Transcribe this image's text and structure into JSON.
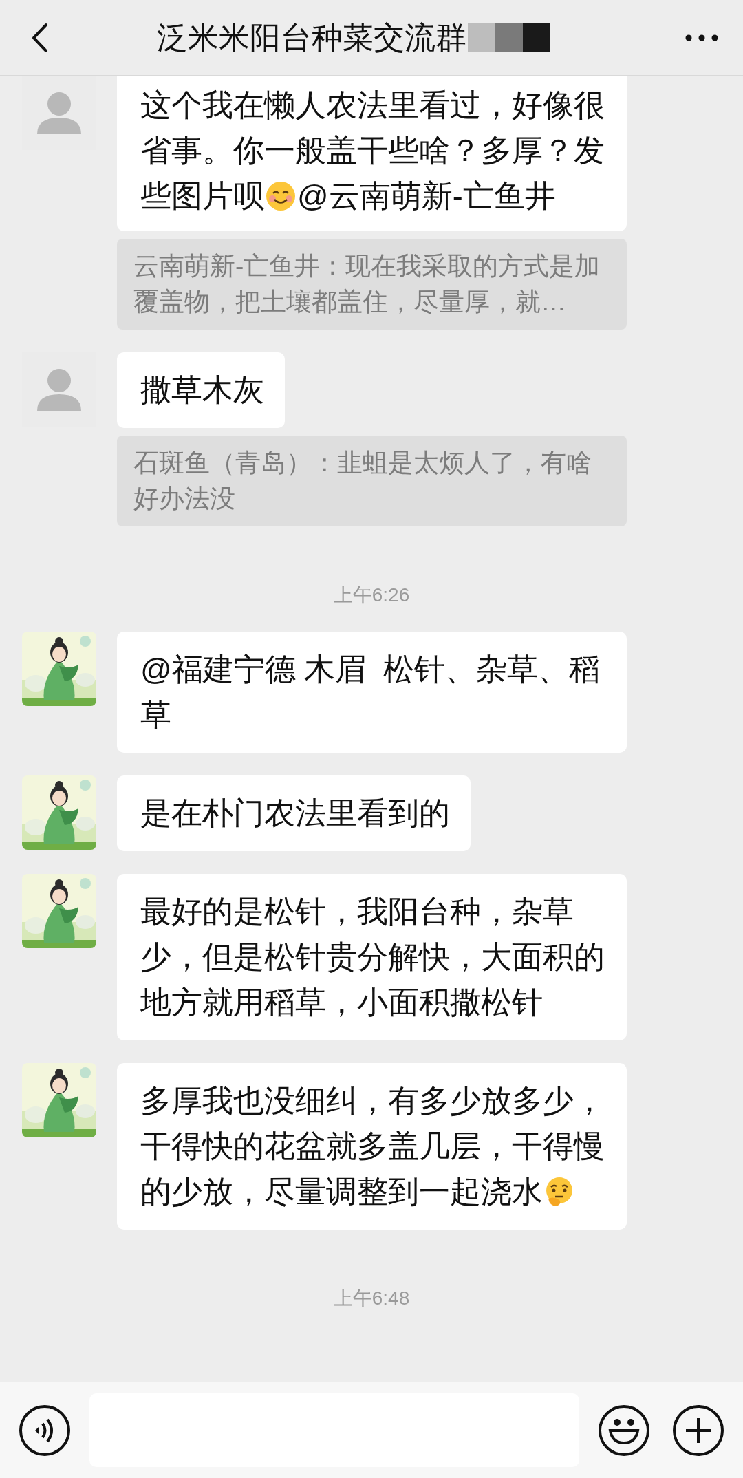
{
  "header": {
    "title": "泛米米阳台种菜交流群"
  },
  "messages": [
    {
      "kind": "message",
      "avatar": {
        "kind": "default"
      },
      "parts": [
        {
          "kind": "text",
          "text": "这个我在懒人农法里看过，好像很省事。你一般盖干些啥？多厚？发"
        },
        {
          "kind": "row",
          "items": [
            {
              "kind": "text",
              "text": "些图片呗"
            },
            {
              "kind": "smile_emoji"
            },
            {
              "kind": "text",
              "text": "@云南萌新-亡鱼井"
            }
          ]
        }
      ],
      "quote": "云南萌新-亡鱼井：现在我采取的方式是加覆盖物，把土壤都盖住，尽量厚，就…"
    },
    {
      "kind": "message",
      "avatar": {
        "kind": "default"
      },
      "parts": [
        {
          "kind": "text",
          "text": "撒草木灰"
        }
      ],
      "quote": "石斑鱼（青岛）：韭蛆是太烦人了，有啥好办法没"
    },
    {
      "kind": "time",
      "text": "上午6:26"
    },
    {
      "kind": "message",
      "avatar": {
        "kind": "picture"
      },
      "parts": [
        {
          "kind": "text",
          "text": "@福建宁德 木眉  松针、杂草、稻草"
        }
      ]
    },
    {
      "kind": "message",
      "avatar": {
        "kind": "picture"
      },
      "parts": [
        {
          "kind": "text",
          "text": "是在朴门农法里看到的"
        }
      ]
    },
    {
      "kind": "message",
      "avatar": {
        "kind": "picture"
      },
      "parts": [
        {
          "kind": "text",
          "text": "最好的是松针，我阳台种，杂草少，但是松针贵分解快，大面积的地方就用稻草，小面积撒松针"
        }
      ]
    },
    {
      "kind": "message",
      "avatar": {
        "kind": "picture"
      },
      "parts": [
        {
          "kind": "text",
          "text": "多厚我也没细纠，有多少放多少，干得快的花盆就多盖几层，干得慢"
        },
        {
          "kind": "row",
          "items": [
            {
              "kind": "text",
              "text": "的少放，尽量调整到一起浇水"
            },
            {
              "kind": "thinking_emoji"
            }
          ]
        }
      ]
    },
    {
      "kind": "time",
      "text": "上午6:48"
    }
  ]
}
